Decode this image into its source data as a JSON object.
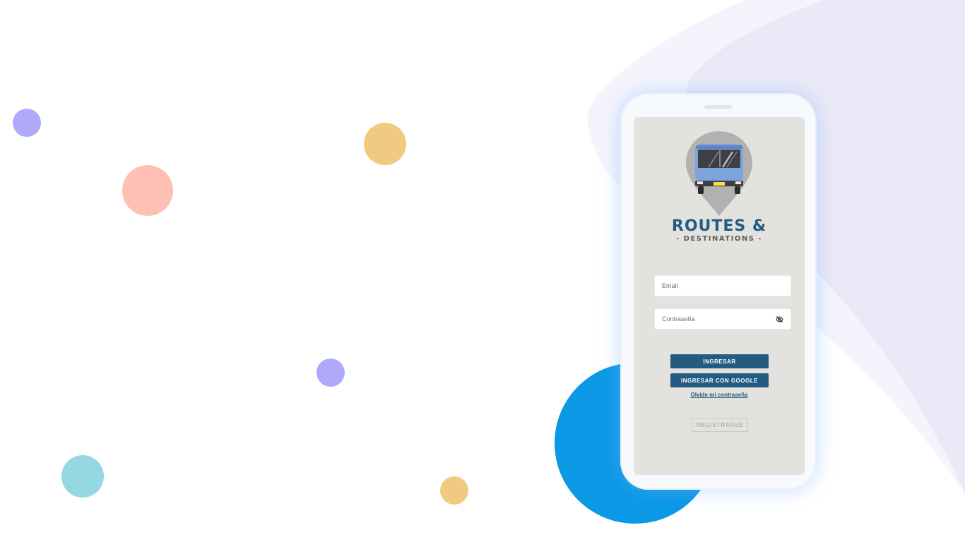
{
  "colors": {
    "page_bg": "#ffffff",
    "wave_light": "#f5f4fd",
    "wave_dark": "#ebe9f7",
    "screen_bg": "#e3e2df",
    "brand_navy": "#235b82",
    "subtitle_gray": "#5b5b5b",
    "button_bg": "#235b82",
    "register_text": "#9a9a9a",
    "big_circle": "#0b98e5",
    "pin_gray": "#b2b1af",
    "bus_blue": "#7ea4dc"
  },
  "decor_circles": [
    {
      "name": "purple-dot",
      "color": "#b0a8fb"
    },
    {
      "name": "salmon-dot",
      "color": "#fdc0b3"
    },
    {
      "name": "yellow-dot",
      "color": "#f0ca80"
    },
    {
      "name": "purple-dot",
      "color": "#b0a8fb"
    },
    {
      "name": "teal-dot",
      "color": "#93d8e3"
    },
    {
      "name": "yellow-dot",
      "color": "#f0ca80"
    }
  ],
  "app": {
    "logo_icon": "bus-location-pin-icon",
    "brand_title": "ROUTES &",
    "brand_subtitle": "- DESTINATIONS -"
  },
  "login_form": {
    "email_placeholder": "Email",
    "password_placeholder": "Contraseña",
    "password_toggle_icon": "eye-off-icon",
    "login_button": "INGRESAR",
    "google_button": "INGRESAR CON GOOGLE",
    "forgot_link": "Olvide mi contraseña",
    "register_button": "REGISTRARSE"
  }
}
